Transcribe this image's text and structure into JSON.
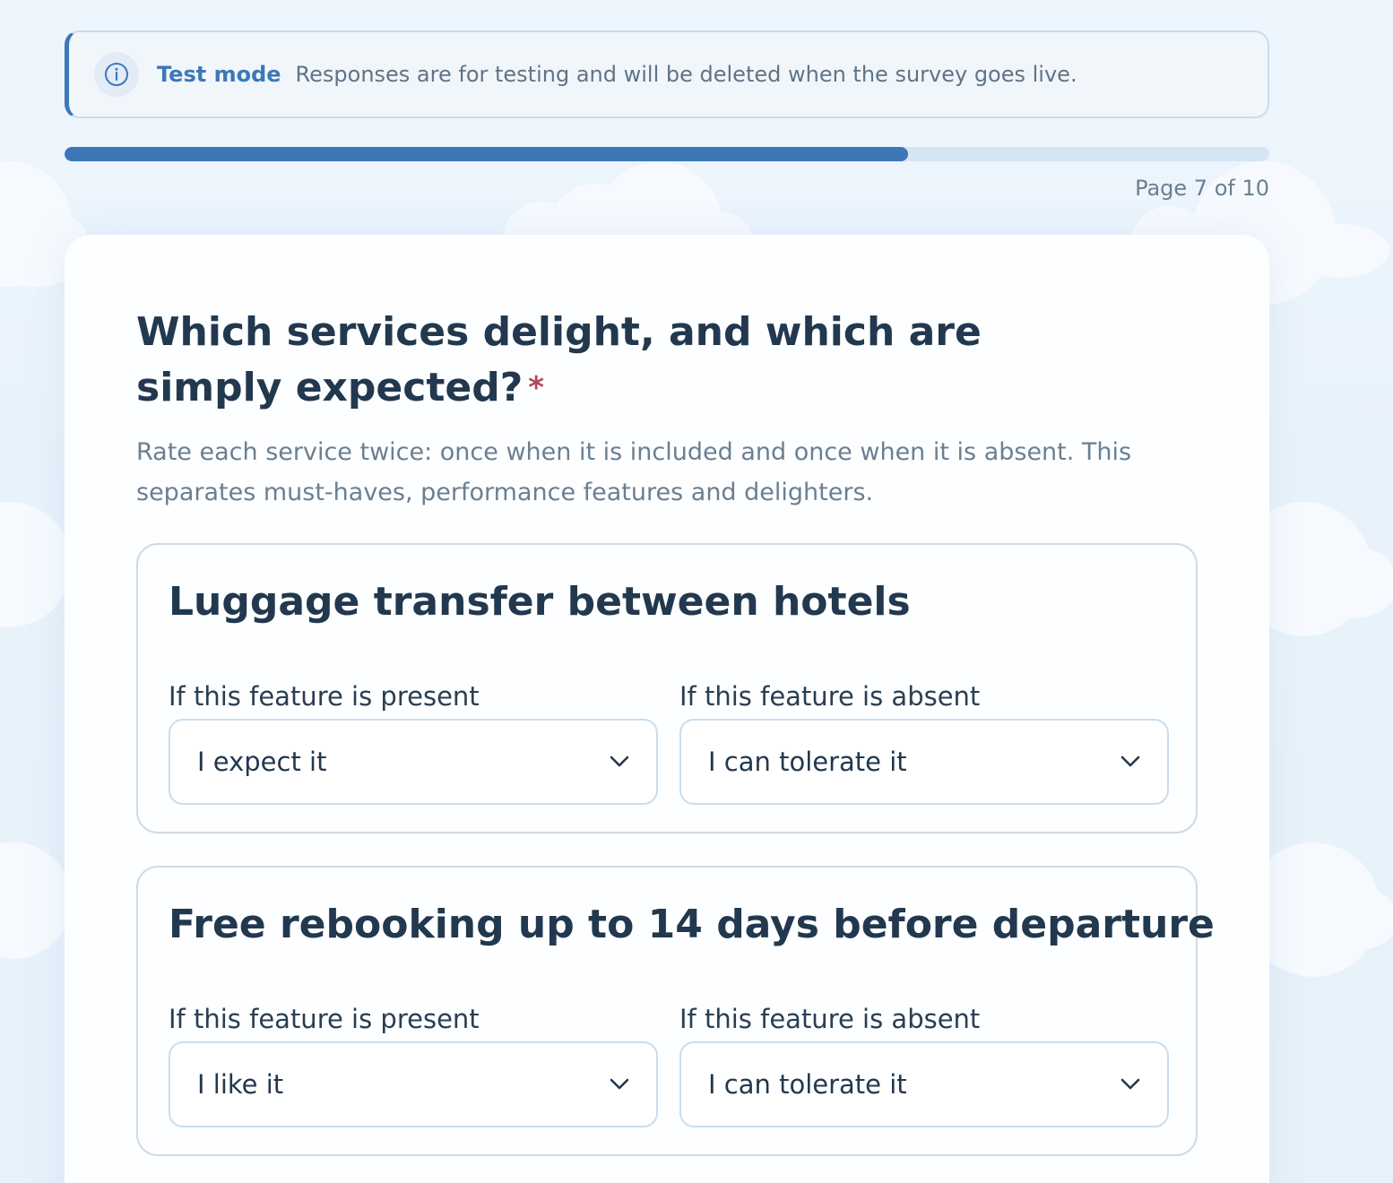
{
  "banner": {
    "title": "Test mode",
    "text": "Responses are for testing and will be deleted when the survey goes live.",
    "icon": "info-icon"
  },
  "progress": {
    "fraction": 0.7,
    "page_text": "Page 7 of 10"
  },
  "question": {
    "title": "Which services delight, and which are simply expected?",
    "required_mark": "*",
    "description": "Rate each service twice: once when it is included and once when it is absent. This separates must-haves, performance features and delighters."
  },
  "features": [
    {
      "title": "Luggage transfer between hotels",
      "present_label": "If this feature is present",
      "present_value": "I expect it",
      "absent_label": "If this feature is absent",
      "absent_value": "I can tolerate it"
    },
    {
      "title": "Free rebooking up to 14 days before departure",
      "present_label": "If this feature is present",
      "present_value": "I like it",
      "absent_label": "If this feature is absent",
      "absent_value": "I can tolerate it"
    }
  ],
  "colors": {
    "accent": "#3d77b8",
    "required": "#b5475a",
    "text": "#22384f",
    "muted": "#6b7f91"
  }
}
